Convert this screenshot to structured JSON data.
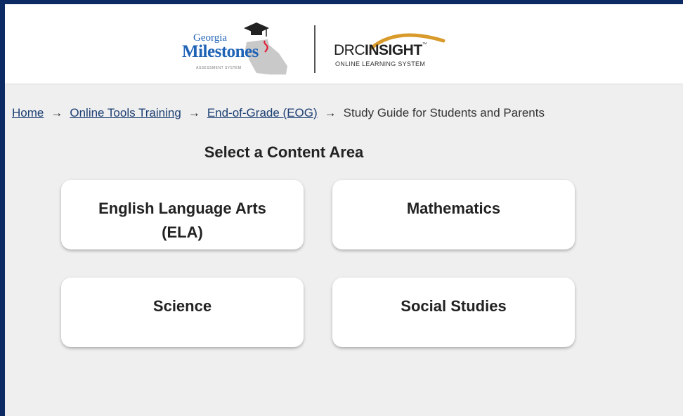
{
  "header": {
    "gm_logo": {
      "line1": "Georgia",
      "line2": "Milestones",
      "tagline": "ASSESSMENT SYSTEM"
    },
    "drc_logo": {
      "brand_prefix": "DRC",
      "brand_name": "INSIGHT",
      "tm": "™",
      "subtitle": "ONLINE LEARNING SYSTEM"
    }
  },
  "breadcrumb": {
    "items": [
      {
        "label": "Home"
      },
      {
        "label": "Online Tools Training"
      },
      {
        "label": "End-of-Grade (EOG)"
      }
    ],
    "current": "Study Guide for Students and Parents",
    "separator": "→"
  },
  "main": {
    "title": "Select a Content Area",
    "cards": [
      {
        "label_line1": "English Language Arts",
        "label_line2": "(ELA)"
      },
      {
        "label_line1": "Mathematics",
        "label_line2": ""
      },
      {
        "label_line1": "Science",
        "label_line2": ""
      },
      {
        "label_line1": "Social Studies",
        "label_line2": ""
      }
    ]
  },
  "colors": {
    "outer_border": "#0c2a63",
    "page_background": "#efefef",
    "link": "#1c3f73",
    "gm_blue": "#1f63b6",
    "drc_gold": "#d89a2a"
  },
  "icons": [
    "graduation-cap-icon",
    "georgia-map-icon",
    "drc-swoosh-icon",
    "arrow-right-icon"
  ]
}
